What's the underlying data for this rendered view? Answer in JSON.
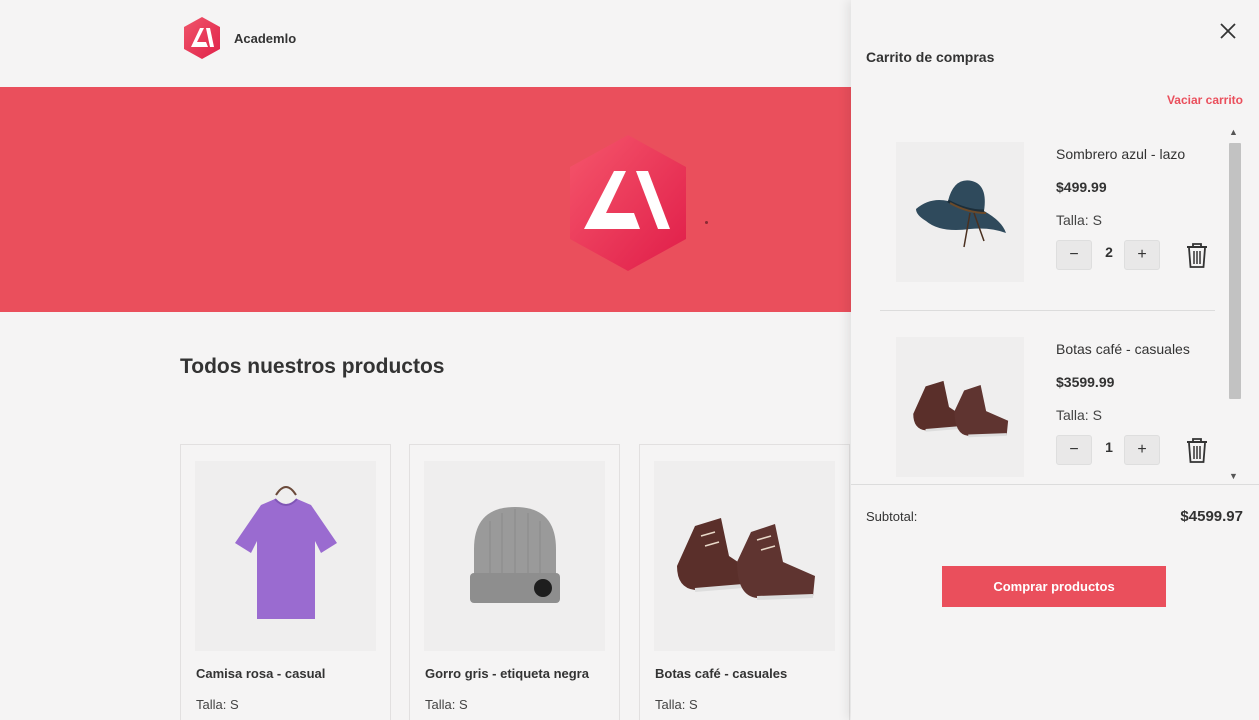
{
  "header": {
    "brand_name": "Academlo",
    "logo_icon": "academlo-logo-icon"
  },
  "hero": {
    "background": "#ea4f5c",
    "logo_icon": "academlo-logo-icon"
  },
  "products": {
    "title": "Todos nuestros productos",
    "items": [
      {
        "name": "Camisa rosa - casual",
        "size": "Talla: S",
        "image_icon": "tshirt-icon"
      },
      {
        "name": "Gorro gris - etiqueta negra",
        "size": "Talla: S",
        "image_icon": "beanie-icon"
      },
      {
        "name": "Botas café - casuales",
        "size": "Talla: S",
        "image_icon": "boots-icon"
      }
    ]
  },
  "cart": {
    "title": "Carrito de compras",
    "empty_label": "Vaciar carrito",
    "items": [
      {
        "name": "Sombrero azul - lazo",
        "price": "$499.99",
        "size": "Talla: S",
        "quantity": "2",
        "minus": "−",
        "plus": "+",
        "image_icon": "hat-icon"
      },
      {
        "name": "Botas café - casuales",
        "price": "$3599.99",
        "size": "Talla: S",
        "quantity": "1",
        "minus": "−",
        "plus": "+",
        "image_icon": "boots-icon"
      }
    ],
    "subtotal_label": "Subtotal:",
    "subtotal_value": "$4599.97",
    "buy_label": "Comprar productos"
  },
  "colors": {
    "accent": "#ea4f5c",
    "background": "#f5f4f4",
    "text": "#333333"
  }
}
